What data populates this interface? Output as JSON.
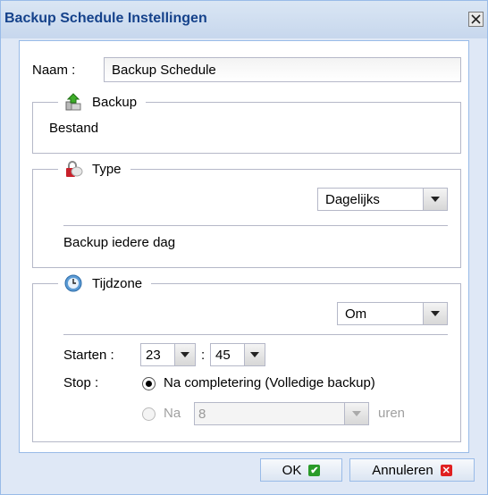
{
  "dialog": {
    "title": "Backup Schedule Instellingen",
    "close_glyph": "X"
  },
  "name": {
    "label": "Naam :",
    "value": "Backup Schedule"
  },
  "backup": {
    "legend": "Backup",
    "icon": "backup-upload-icon",
    "value": "Bestand"
  },
  "type": {
    "legend": "Type",
    "icon": "lock-icon",
    "select_value": "Dagelijks",
    "description": "Backup iedere dag"
  },
  "timezone": {
    "legend": "Tijdzone",
    "icon": "clock-icon",
    "select_value": "Om",
    "start_label": "Starten :",
    "start_hour": "23",
    "separator": ":",
    "start_minute": "45",
    "stop_label": "Stop :",
    "option_complete": "Na completering (Volledige backup)",
    "option_after_label": "Na",
    "option_after_value": "8",
    "option_after_unit": "uren"
  },
  "buttons": {
    "ok": "OK",
    "cancel": "Annuleren"
  },
  "colors": {
    "title": "#15428b",
    "frame": "#dfe8f6",
    "border": "#99bbe8"
  }
}
